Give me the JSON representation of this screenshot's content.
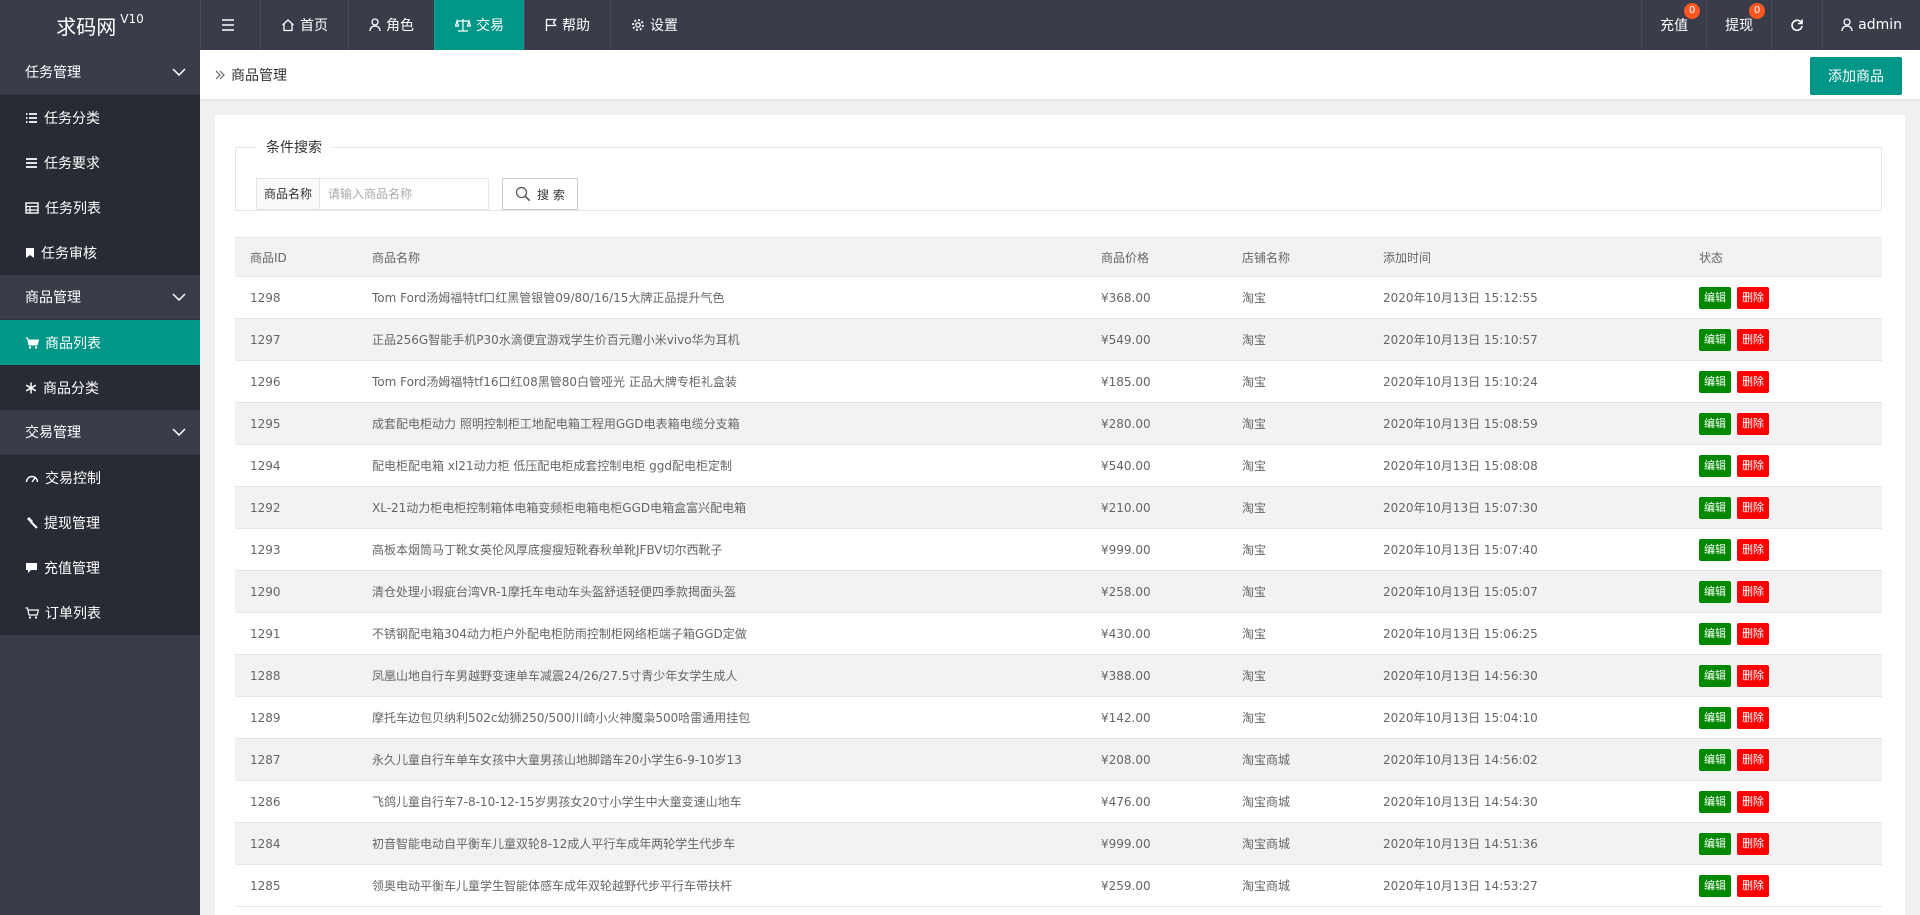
{
  "app": {
    "logo": "求码网",
    "version": "V10"
  },
  "topnav": [
    {
      "label": "首页",
      "icon": "home-icon"
    },
    {
      "label": "角色",
      "icon": "user-icon"
    },
    {
      "label": "交易",
      "icon": "scale-icon"
    },
    {
      "label": "帮助",
      "icon": "flag-icon"
    },
    {
      "label": "设置",
      "icon": "gear-icon"
    }
  ],
  "topright": {
    "recharge": "充值",
    "recharge_badge": "0",
    "withdraw": "提现",
    "withdraw_badge": "0",
    "user": "admin"
  },
  "sidebar": {
    "groups": [
      {
        "title": "任务管理",
        "items": [
          "任务分类",
          "任务要求",
          "任务列表",
          "任务审核"
        ]
      },
      {
        "title": "商品管理",
        "items": [
          "商品列表",
          "商品分类"
        ]
      },
      {
        "title": "交易管理",
        "items": [
          "交易控制",
          "提现管理",
          "充值管理",
          "订单列表"
        ]
      }
    ]
  },
  "breadcrumb": "商品管理",
  "add_button": "添加商品",
  "search": {
    "legend": "条件搜索",
    "label": "商品名称",
    "placeholder": "请输入商品名称",
    "button": "搜 索"
  },
  "table": {
    "headers": [
      "商品ID",
      "商品名称",
      "商品价格",
      "店铺名称",
      "添加时间",
      "状态"
    ],
    "edit_label": "编辑",
    "delete_label": "删除",
    "rows": [
      [
        "1298",
        "Tom Ford汤姆福特tf口红黑管银管09/80/16/15大牌正品提升气色",
        "¥368.00",
        "淘宝",
        "2020年10月13日 15:12:55"
      ],
      [
        "1297",
        "正品256G智能手机P30水滴便宜游戏学生价百元赠小米vivo华为耳机",
        "¥549.00",
        "淘宝",
        "2020年10月13日 15:10:57"
      ],
      [
        "1296",
        "Tom Ford汤姆福特tf16口红08黑管80白管哑光 正品大牌专柜礼盒装",
        "¥185.00",
        "淘宝",
        "2020年10月13日 15:10:24"
      ],
      [
        "1295",
        "成套配电柜动力 照明控制柜工地配电箱工程用GGD电表箱电缆分支箱",
        "¥280.00",
        "淘宝",
        "2020年10月13日 15:08:59"
      ],
      [
        "1294",
        "配电柜配电箱 xl21动力柜 低压配电柜成套控制电柜 ggd配电柜定制",
        "¥540.00",
        "淘宝",
        "2020年10月13日 15:08:08"
      ],
      [
        "1292",
        "XL-21动力柜电柜控制箱体电箱变频柜电箱电柜GGD电箱盒富兴配电箱",
        "¥210.00",
        "淘宝",
        "2020年10月13日 15:07:30"
      ],
      [
        "1293",
        "高板本烟筒马丁靴女英伦风厚底瘦瘦短靴春秋单靴JFBV切尔西靴子",
        "¥999.00",
        "淘宝",
        "2020年10月13日 15:07:40"
      ],
      [
        "1290",
        "清仓处理小瑕疵台湾VR-1摩托车电动车头盔舒适轻便四季款揭面头盔",
        "¥258.00",
        "淘宝",
        "2020年10月13日 15:05:07"
      ],
      [
        "1291",
        "不锈钢配电箱304动力柜户外配电柜防雨控制柜网络柜端子箱GGD定做",
        "¥430.00",
        "淘宝",
        "2020年10月13日 15:06:25"
      ],
      [
        "1288",
        "凤凰山地自行车男越野变速单车减震24/26/27.5寸青少年女学生成人",
        "¥388.00",
        "淘宝",
        "2020年10月13日 14:56:30"
      ],
      [
        "1289",
        "摩托车边包贝纳利502c幼狮250/500川崎小火神魔枭500哈雷通用挂包",
        "¥142.00",
        "淘宝",
        "2020年10月13日 15:04:10"
      ],
      [
        "1287",
        "永久儿童自行车单车女孩中大童男孩山地脚踏车20小学生6-9-10岁13",
        "¥208.00",
        "淘宝商城",
        "2020年10月13日 14:56:02"
      ],
      [
        "1286",
        "飞鸽儿童自行车7-8-10-12-15岁男孩女20寸小学生中大童变速山地车",
        "¥476.00",
        "淘宝商城",
        "2020年10月13日 14:54:30"
      ],
      [
        "1284",
        "初音智能电动自平衡车儿童双轮8-12成人平行车成年两轮学生代步车",
        "¥999.00",
        "淘宝商城",
        "2020年10月13日 14:51:36"
      ],
      [
        "1285",
        "领奥电动平衡车儿童学生智能体感车成年双轮越野代步平行车带扶杆",
        "¥259.00",
        "淘宝商城",
        "2020年10月13日 14:53:27"
      ]
    ]
  },
  "colors": {
    "dark": "#393D49",
    "accent": "#009688",
    "edit": "#008800",
    "delete": "#FF0000",
    "badge": "#FF5722"
  }
}
